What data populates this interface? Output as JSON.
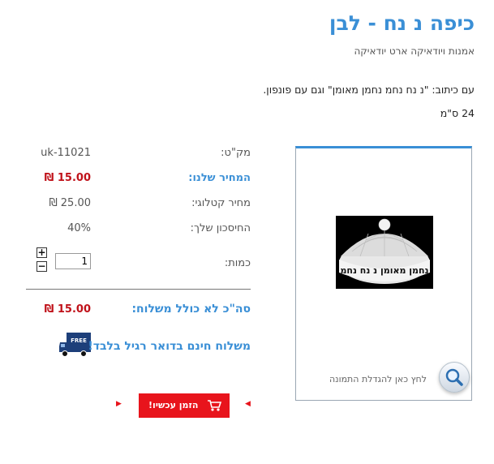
{
  "product": {
    "title": "כיפה נ נח - לבן",
    "category": "אמנות ויודאיקה ארט יודאיקה",
    "description": "עם כיתוב: \"נ נח נחמ נחמן מאומן\" וגם עם פונפון.",
    "size": "24 ס\"מ",
    "image_zoom_text": "לחץ כאן להגדלת התמונה",
    "image_text": "נחמן מאומן נ נח נחמ"
  },
  "details": {
    "sku_label": "מק\"ט:",
    "sku_value": "uk-11021",
    "our_price_label": "המחיר שלנו:",
    "our_price_value": "15.00 ₪",
    "catalog_price_label": "מחיר קטלוגי:",
    "catalog_price_value": "25.00 ₪",
    "savings_label": "החיסכון שלך:",
    "savings_value": "40%",
    "qty_label": "כמות:",
    "qty_value": "1",
    "plus": "+",
    "minus": "−",
    "total_label": "סה\"כ לא כולל משלוח:",
    "total_value": "15.00 ₪"
  },
  "shipping": {
    "text": "משלוח חינם בדואר רגיל בלבד!",
    "badge": "FREE"
  },
  "order": {
    "button_label": "הזמן עכשיו!"
  },
  "colors": {
    "accent_blue": "#3a8fd6",
    "price_red": "#c0121a",
    "button_red": "#e8141c"
  }
}
